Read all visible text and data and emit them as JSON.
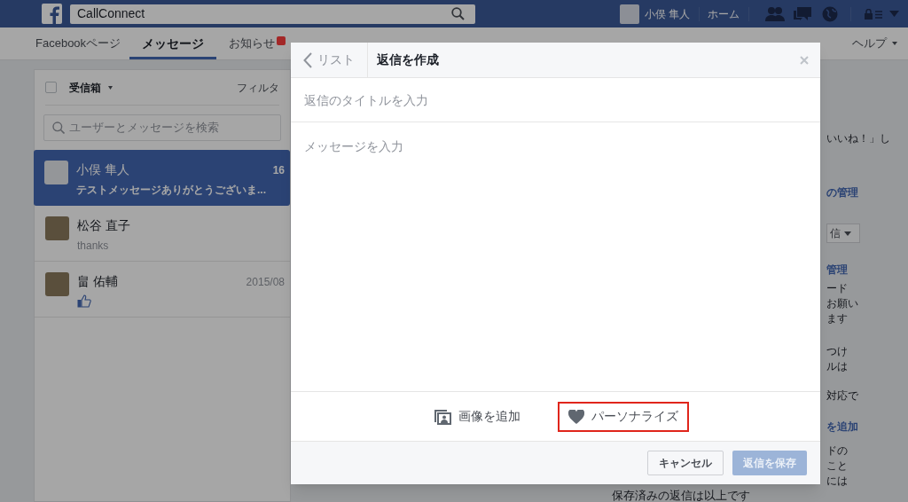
{
  "topbar": {
    "search_value": "CallConnect",
    "profile_name": "小俣 隼人",
    "home": "ホーム"
  },
  "page_tabs": [
    {
      "label": "Facebookページ",
      "selected": false,
      "badge": false
    },
    {
      "label": "メッセージ",
      "selected": true,
      "badge": false
    },
    {
      "label": "お知らせ",
      "selected": false,
      "badge": true
    }
  ],
  "page_tabs_right": [
    "ヘルプ"
  ],
  "inbox": {
    "select_all_checked": false,
    "folder": "受信箱",
    "filter": "フィルタ",
    "search_placeholder": "ユーザーとメッセージを検索",
    "conversations": [
      {
        "name": "小俣 隼人",
        "time": "16",
        "snippet": "テストメッセージありがとうございま...",
        "selected": true,
        "kind": "text"
      },
      {
        "name": "松谷 直子",
        "snippet": "thanks",
        "selected": false,
        "kind": "text"
      },
      {
        "name": "畠 佑輔",
        "time": "2015/08",
        "selected": false,
        "kind": "like"
      }
    ]
  },
  "right_fragments": [
    {
      "kind": "text",
      "text": "いいね！」し"
    },
    {
      "kind": "link",
      "text": "の管理"
    },
    {
      "kind": "dropdown",
      "text": "信"
    },
    {
      "kind": "link",
      "text": "管理"
    },
    {
      "kind": "text",
      "text": "ード"
    },
    {
      "kind": "text",
      "text": "お願い"
    },
    {
      "kind": "text",
      "text": "ます"
    },
    {
      "kind": "text",
      "text": "つけ"
    },
    {
      "kind": "text",
      "text": "ルは"
    },
    {
      "kind": "text",
      "text": "対応で"
    },
    {
      "kind": "link",
      "text": "を追加"
    },
    {
      "kind": "text",
      "text": "ドの"
    },
    {
      "kind": "text",
      "text": "こと"
    },
    {
      "kind": "text",
      "text": "には"
    }
  ],
  "saved_end_note": "保存済みの返信は以上です",
  "modal": {
    "back": "リスト",
    "title": "返信を作成",
    "title_placeholder": "返信のタイトルを入力",
    "message_placeholder": "メッセージを入力",
    "actions": [
      {
        "kind": "image",
        "label": "画像を追加",
        "highlighted": false
      },
      {
        "kind": "personalize",
        "label": "パーソナライズ",
        "highlighted": true
      }
    ],
    "cancel": "キャンセル",
    "save": {
      "label": "返信を保存",
      "disabled": true
    }
  }
}
